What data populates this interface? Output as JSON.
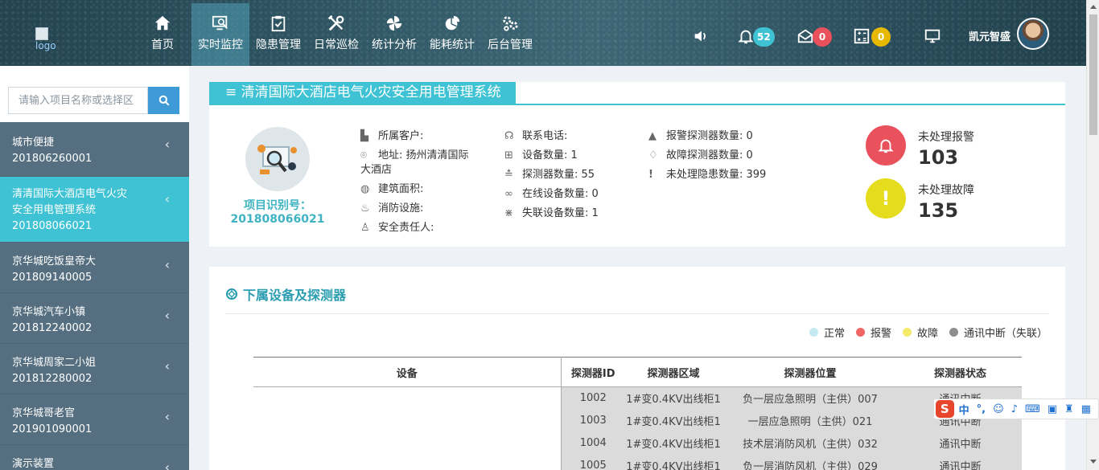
{
  "header": {
    "logo_alt": "logo",
    "nav": [
      {
        "label": "首页",
        "icon": "home-icon"
      },
      {
        "label": "实时监控",
        "icon": "monitor-search-icon",
        "active": true
      },
      {
        "label": "隐患管理",
        "icon": "clipboard-check-icon"
      },
      {
        "label": "日常巡检",
        "icon": "tools-icon"
      },
      {
        "label": "统计分析",
        "icon": "pinwheel-icon"
      },
      {
        "label": "能耗统计",
        "icon": "pie-chart-icon"
      },
      {
        "label": "后台管理",
        "icon": "gears-icon"
      }
    ],
    "badges": {
      "alarms": "52",
      "messages": "0",
      "tasks": "0"
    },
    "username": "凯元智盛"
  },
  "sidebar": {
    "search_placeholder": "请输入项目名称或选择区",
    "projects": [
      {
        "name": "城市便捷",
        "code": "201806260001"
      },
      {
        "name": "清清国际大酒店电气火灾安全用电管理系统",
        "name_line1": "清清国际大酒店电气火灾",
        "name_line2": "安全用电管理系统",
        "code": "201808066021",
        "active": true
      },
      {
        "name": "京华城吃饭皇帝大",
        "code": "201809140005"
      },
      {
        "name": "京华城汽车小镇",
        "code": "201812240002"
      },
      {
        "name": "京华城周家二小姐",
        "code": "201812280002"
      },
      {
        "name": "京华城哥老官",
        "code": "201901090001"
      },
      {
        "name": "演示装置",
        "code": ""
      }
    ]
  },
  "project": {
    "title": "清清国际大酒店电气火灾安全用电管理系统",
    "id_label": "项目识别号：",
    "id_value": "201808066021",
    "col1": [
      {
        "icon": "building-icon",
        "text": "所属客户:"
      },
      {
        "icon": "location-pin-icon",
        "text": "地址: 扬州清清国际",
        "text2": "大酒店"
      },
      {
        "icon": "area-icon",
        "text": "建筑面积:"
      },
      {
        "icon": "fire-icon",
        "text": "消防设施:"
      },
      {
        "icon": "person-icon",
        "text": "安全责任人:"
      }
    ],
    "col2": [
      {
        "icon": "headset-icon",
        "text": "联系电话:"
      },
      {
        "icon": "grid-icon",
        "text": "设备数量: 1"
      },
      {
        "icon": "sliders-icon",
        "text": "探测器数量: 55"
      },
      {
        "icon": "link-icon",
        "text": "在线设备数量: 0"
      },
      {
        "icon": "broken-link-icon",
        "text": "失联设备数量: 1"
      }
    ],
    "col3": [
      {
        "icon": "warning-icon",
        "text": "报警探测器数量: 0"
      },
      {
        "icon": "bell-outline-icon",
        "text": "故障探测器数量: 0"
      },
      {
        "icon": "exclamation-icon",
        "text": "未处理隐患数量: 399"
      }
    ],
    "unhandled_alarm_label": "未处理报警",
    "unhandled_alarm_value": "103",
    "unhandled_fault_label": "未处理故障",
    "unhandled_fault_value": "135"
  },
  "devices": {
    "title": "下属设备及探测器",
    "legend": [
      {
        "label": "正常",
        "color": "#c6eaf3"
      },
      {
        "label": "报警",
        "color": "#f06565"
      },
      {
        "label": "故障",
        "color": "#f3ea6a"
      },
      {
        "label": "通讯中断（失联）",
        "color": "#8d8d8d"
      }
    ],
    "columns": [
      "设备",
      "探测器ID",
      "探测器区域",
      "探测器位置",
      "探测器状态"
    ],
    "rows": [
      {
        "id": "1002",
        "area": "1#变0.4KV出线柜1",
        "pos": "负一层应急照明（主供）007",
        "status": "通讯中断"
      },
      {
        "id": "1003",
        "area": "1#变0.4KV出线柜1",
        "pos": "一层应急照明（主供）021",
        "status": "通讯中断"
      },
      {
        "id": "1004",
        "area": "1#变0.4KV出线柜1",
        "pos": "技术层消防风机（主供）032",
        "status": "通讯中断"
      },
      {
        "id": "1005",
        "area": "1#变0.4KV出线柜1",
        "pos": "负一层消防风机（主供）029",
        "status": "通讯中断"
      }
    ]
  },
  "ime": {
    "lang": "中"
  },
  "colors": {
    "accent": "#3fc2d3",
    "sidebar": "#566f80",
    "alarm_red": "#e9515c",
    "fault_yellow": "#e6dc1e"
  }
}
